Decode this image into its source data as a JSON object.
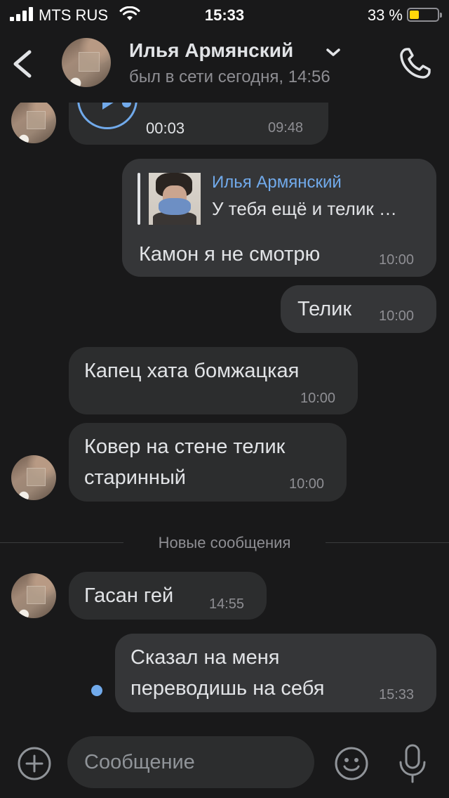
{
  "status_bar": {
    "carrier": "MTS RUS",
    "time": "15:33",
    "battery_percent": "33 %",
    "battery_level": 0.33,
    "battery_color": "#ffd60a"
  },
  "header": {
    "name": "Илья Армянский",
    "status": "был в сети сегодня, 14:56",
    "back_icon": "chevron-left-icon",
    "dropdown_icon": "chevron-down-icon",
    "call_icon": "phone-icon"
  },
  "messages": [
    {
      "kind": "voice",
      "direction": "in",
      "duration": "00:03",
      "time": "09:48"
    },
    {
      "kind": "reply",
      "direction": "out",
      "reply_author": "Илья Армянский",
      "reply_text": "У тебя ещё и телик …",
      "text": "Камон я не смотрю",
      "time": "10:00"
    },
    {
      "kind": "text",
      "direction": "out",
      "text": "Телик",
      "time": "10:00"
    },
    {
      "kind": "text",
      "direction": "in",
      "text": "Капец хата бомжацкая",
      "time": "10:00"
    },
    {
      "kind": "text",
      "direction": "in",
      "text": "Ковер на стене телик\nстаринный",
      "time": "10:00"
    },
    {
      "kind": "text",
      "direction": "in",
      "text": "Гасан гей",
      "time": "14:55"
    },
    {
      "kind": "text",
      "direction": "out",
      "text": "Сказал на меня\nпереводишь на себя",
      "time": "15:33",
      "unread": true
    }
  ],
  "divider": {
    "label": "Новые сообщения"
  },
  "composer": {
    "placeholder": "Сообщение",
    "attach_icon": "plus-circle-icon",
    "emoji_icon": "smile-icon",
    "mic_icon": "microphone-icon"
  },
  "colors": {
    "background": "#19191a",
    "bubble_in": "#2c2d2e",
    "bubble_out": "#353638",
    "accent": "#71aaeb",
    "text": "#e1e3e6",
    "secondary": "#8e8e93"
  }
}
